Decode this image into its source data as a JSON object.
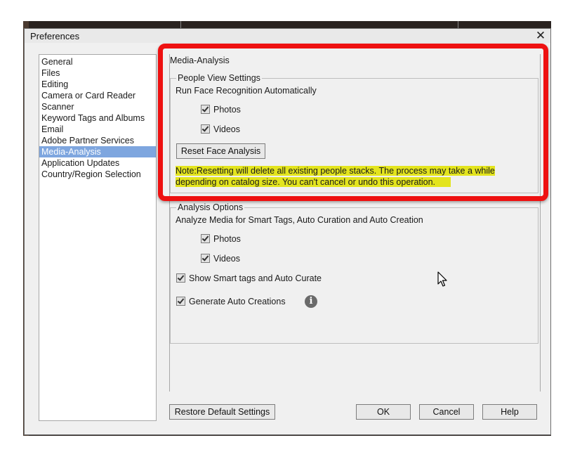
{
  "dialog": {
    "title": "Preferences",
    "close_glyph": "✕"
  },
  "sidebar": {
    "items": [
      {
        "label": "General"
      },
      {
        "label": "Files"
      },
      {
        "label": "Editing"
      },
      {
        "label": "Camera or Card Reader"
      },
      {
        "label": "Scanner"
      },
      {
        "label": "Keyword Tags and Albums"
      },
      {
        "label": "Email"
      },
      {
        "label": "Adobe Partner Services"
      },
      {
        "label": "Media-Analysis",
        "selected": true
      },
      {
        "label": "Application Updates"
      },
      {
        "label": "Country/Region Selection"
      }
    ]
  },
  "main": {
    "section_title": "Media-Analysis",
    "people_view": {
      "legend": "People View Settings",
      "run_label": "Run Face Recognition Automatically",
      "photos_label": "Photos",
      "photos_checked": true,
      "videos_label": "Videos",
      "videos_checked": true,
      "reset_button": "Reset Face Analysis",
      "note_line1": "Note:Resetting will delete all existing people stacks. The process may take a while",
      "note_line2": "depending on catalog size. You can't cancel or undo this operation."
    },
    "analysis": {
      "legend": "Analysis Options",
      "analyze_label": "Analyze Media for Smart Tags, Auto Curation and Auto Creation",
      "photos_label": "Photos",
      "photos_checked": true,
      "videos_label": "Videos",
      "videos_checked": true,
      "smart_tags_label": "Show Smart tags and Auto Curate",
      "smart_tags_checked": true,
      "auto_creations_label": "Generate Auto Creations",
      "auto_creations_checked": true,
      "info_glyph": "i"
    }
  },
  "footer": {
    "restore_button": "Restore Default Settings",
    "ok_button": "OK",
    "cancel_button": "Cancel",
    "help_button": "Help"
  },
  "colors": {
    "highlight_frame": "#ee1111",
    "note_highlight": "#e3e41d",
    "selection": "#7ea6df"
  }
}
